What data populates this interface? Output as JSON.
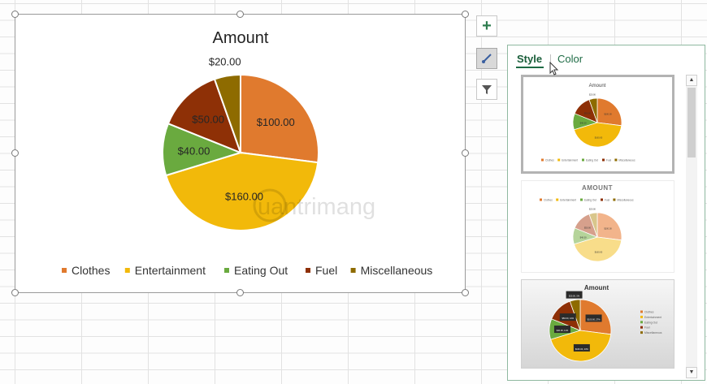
{
  "chart_data": {
    "type": "pie",
    "title": "Amount",
    "categories": [
      "Clothes",
      "Entertainment",
      "Eating Out",
      "Fuel",
      "Miscellaneous"
    ],
    "values": [
      100,
      160,
      40,
      50,
      20
    ],
    "data_labels": [
      "$100.00",
      "$160.00",
      "$40.00",
      "$50.00",
      "$20.00"
    ],
    "colors": [
      "#e07a2e",
      "#f2b90a",
      "#6aaa3f",
      "#8e3006",
      "#8e6b00"
    ],
    "legend_position": "bottom"
  },
  "side_buttons": [
    {
      "name": "chart-elements-button",
      "icon": "plus-icon",
      "glyph": "+"
    },
    {
      "name": "chart-styles-button",
      "icon": "paintbrush-icon"
    },
    {
      "name": "chart-filters-button",
      "icon": "filter-icon"
    }
  ],
  "panel": {
    "tabs": [
      "Style",
      "Color"
    ],
    "active_tab": "Style",
    "style_thumbnails": [
      {
        "title": "Amount",
        "labels": [
          "$100.00",
          "$160.00",
          "$40.00",
          "$50.00",
          "$20.00"
        ],
        "legend": [
          "Clothes",
          "Entertainment",
          "Eating Out",
          "Fuel",
          "Miscellaneous"
        ]
      },
      {
        "title": "AMOUNT",
        "labels": [
          "$100.00",
          "$160.00",
          "$40.00",
          "$50.00",
          "$20.00"
        ],
        "legend": [
          "Clothes",
          "Entertainment",
          "Eating Out",
          "Fuel",
          "Miscellaneous"
        ]
      },
      {
        "title": "Amount",
        "labels": [
          "$100.00, 27%",
          "$160.00, 43%",
          "$40.00, 11%",
          "$50.00, 14%",
          "$20.00, 5%"
        ],
        "legend": [
          "Clothes",
          "Entertainment",
          "Eating Out",
          "Fuel",
          "Miscellaneous"
        ]
      }
    ]
  },
  "watermark": "uantrimang"
}
